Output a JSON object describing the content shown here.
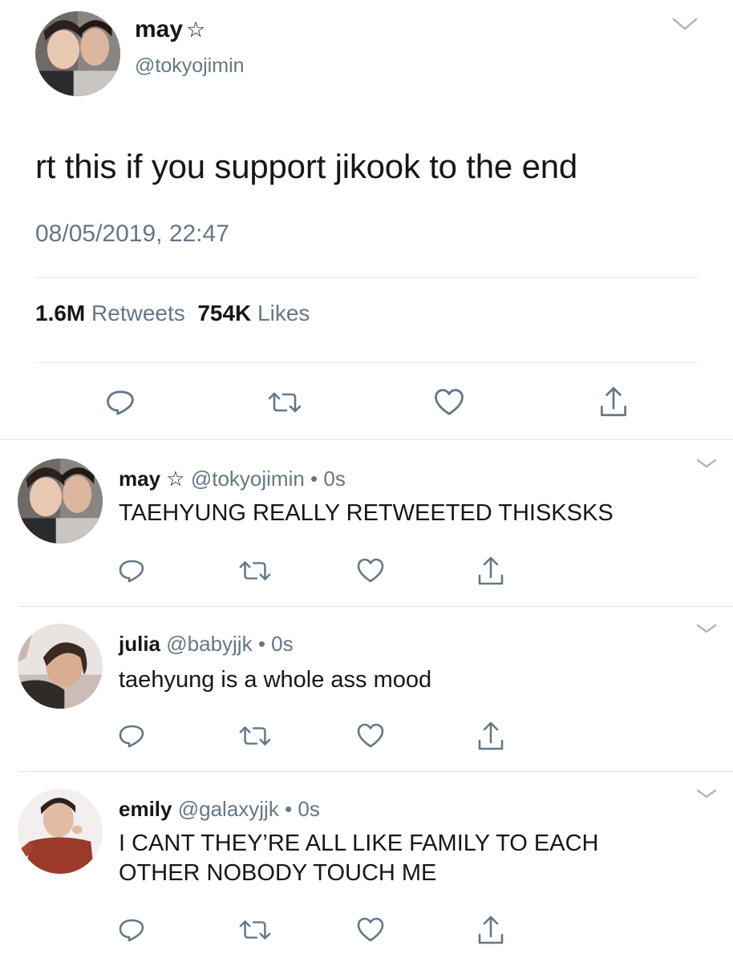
{
  "main_tweet": {
    "display_name": "may",
    "star": "☆",
    "handle": "@tokyojimin",
    "text": "rt this if you support jikook to the end",
    "timestamp": "08/05/2019, 22:47",
    "retweets_count": "1.6M",
    "retweets_label": "Retweets",
    "likes_count": "754K",
    "likes_label": "Likes"
  },
  "replies": [
    {
      "display_name": "may",
      "star": "☆",
      "handle": "@tokyojimin",
      "separator": "•",
      "time": "0s",
      "text": "TAEHYUNG REALLY RETWEETED THISKSKS"
    },
    {
      "display_name": "julia",
      "star": "",
      "handle": "@babyjjk",
      "separator": "•",
      "time": "0s",
      "text": "taehyung is a whole ass mood"
    },
    {
      "display_name": "emily",
      "star": "",
      "handle": "@galaxyjjk",
      "separator": "•",
      "time": "0s",
      "text": "I CANT THEY’RE ALL LIKE FAMILY TO EACH OTHER NOBODY TOUCH ME"
    }
  ],
  "icons": {
    "reply": "reply-icon",
    "retweet": "retweet-icon",
    "like": "heart-icon",
    "share": "share-icon",
    "menu": "chevron-down-icon"
  },
  "colors": {
    "text": "#14171a",
    "secondary": "#657786",
    "icon": "#657786",
    "divider": "#e1e8ed"
  }
}
